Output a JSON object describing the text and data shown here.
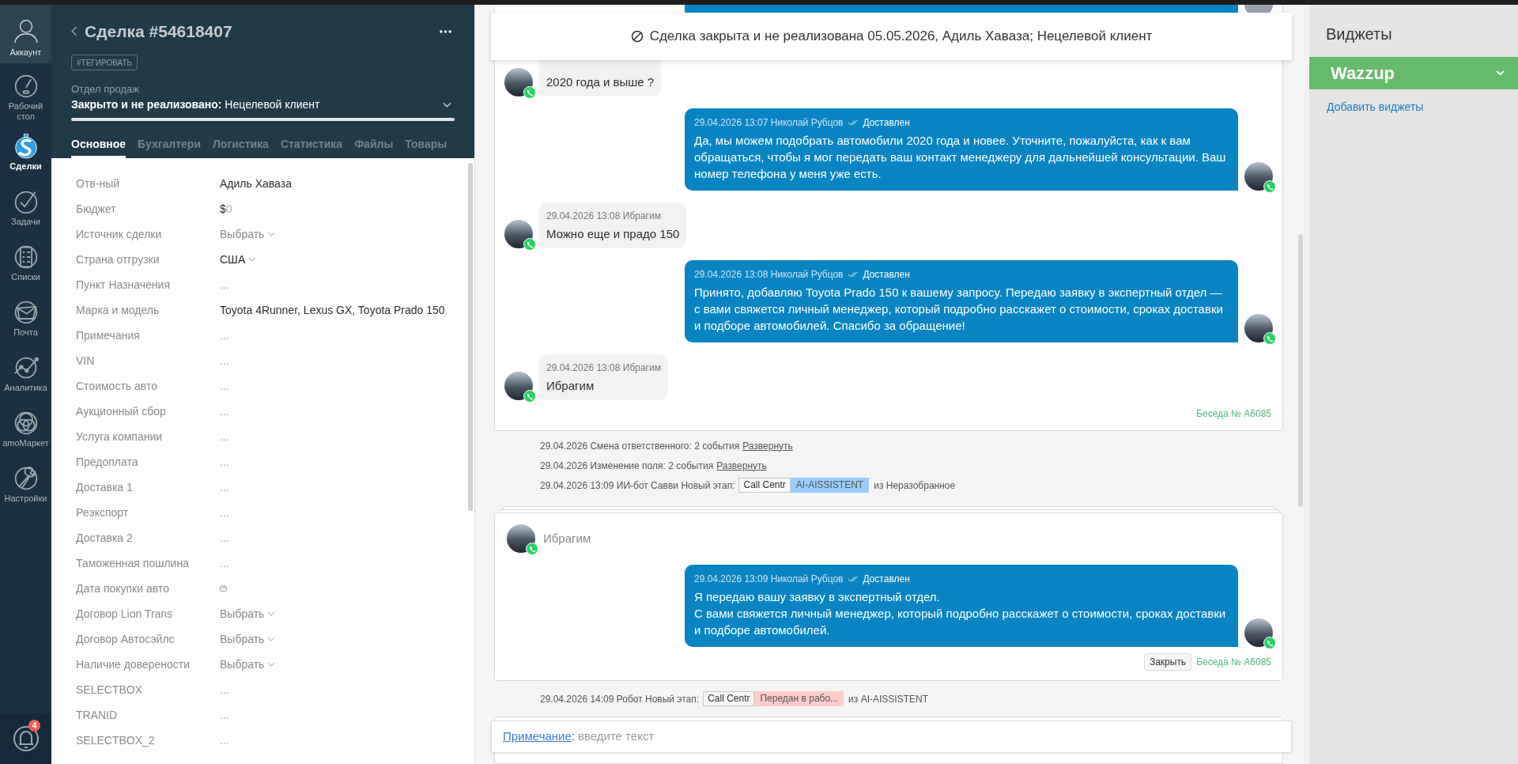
{
  "nav": {
    "account": {
      "label": "Аккаунт"
    },
    "items": [
      {
        "label": "Рабочий стол",
        "selected": false
      },
      {
        "label": "Сделки",
        "selected": true
      },
      {
        "label": "Задачи",
        "selected": false
      },
      {
        "label": "Списки",
        "selected": false
      },
      {
        "label": "Почта",
        "selected": false
      },
      {
        "label": "Аналитика",
        "selected": false
      },
      {
        "label": "amoМаркет",
        "selected": false
      },
      {
        "label": "Настройки",
        "selected": false
      }
    ],
    "notifications": {
      "badge": "4"
    }
  },
  "deal": {
    "title": "Сделка #54618407",
    "tag_button": "#ТЕГИРОВАТЬ",
    "pipeline": "Отдел продаж",
    "status": "**Закрыто и не реализовано:** Нецелевой клиент",
    "status_progress": {
      "level": 1
    },
    "tabs": [
      {
        "label": "Основное",
        "selected": true
      },
      {
        "label": "Бухгалтери",
        "selected": false
      },
      {
        "label": "Логистика",
        "selected": false
      },
      {
        "label": "Статистика",
        "selected": false
      },
      {
        "label": "Файлы",
        "selected": false
      },
      {
        "label": "Товары",
        "selected": false
      }
    ],
    "fields": [
      {
        "label": "Отв-ный",
        "kind": "text",
        "value": "Адиль Хаваза"
      },
      {
        "label": "Бюджет",
        "kind": "budget",
        "currency": "$",
        "value": "0"
      },
      {
        "label": "Источник сделки",
        "kind": "select",
        "placeholder": "Выбрать"
      },
      {
        "label": "Страна отгрузки",
        "kind": "select",
        "value": "США"
      },
      {
        "label": "Пункт Назначения",
        "kind": "empty",
        "placeholder": "..."
      },
      {
        "label": "Марка и модель",
        "kind": "text",
        "value": "Toyota 4Runner, Lexus GX, Toyota Prado 150"
      },
      {
        "label": "Примечания",
        "kind": "empty",
        "placeholder": "..."
      },
      {
        "label": "VIN",
        "kind": "empty",
        "placeholder": "..."
      },
      {
        "label": "Стоимость авто",
        "kind": "empty",
        "placeholder": "..."
      },
      {
        "label": "Аукционный сбор",
        "kind": "empty",
        "placeholder": "..."
      },
      {
        "label": "Услуга компании",
        "kind": "empty",
        "placeholder": "..."
      },
      {
        "label": "Предоплата",
        "kind": "empty",
        "placeholder": "..."
      },
      {
        "label": "Доставка 1",
        "kind": "empty",
        "placeholder": "..."
      },
      {
        "label": "Реэкспорт",
        "kind": "empty",
        "placeholder": "..."
      },
      {
        "label": "Доставка 2",
        "kind": "empty",
        "placeholder": "..."
      },
      {
        "label": "Таможенная пошлина",
        "kind": "empty",
        "placeholder": "..."
      },
      {
        "label": "Дата покупки авто",
        "kind": "date"
      },
      {
        "label": "Договор Lion Trans",
        "kind": "select",
        "placeholder": "Выбрать"
      },
      {
        "label": "Договор Автосэйлс",
        "kind": "select",
        "placeholder": "Выбрать"
      },
      {
        "label": "Наличие доверености",
        "kind": "select",
        "placeholder": "Выбрать"
      },
      {
        "label": "SELECTBOX",
        "kind": "empty",
        "placeholder": "..."
      },
      {
        "label": "TRANID",
        "kind": "empty",
        "placeholder": "..."
      },
      {
        "label": "SELECTBOX_2",
        "kind": "empty",
        "placeholder": "..."
      }
    ]
  },
  "chat": {
    "banner": "Сделка закрыта и не реализована 05.05.2026, Адиль Хаваза; Нецелевой клиент",
    "feed": [
      {
        "kind": "partial_card",
        "messages": [
          {
            "kind": "incoming",
            "text": "2020 года и выше ?"
          },
          {
            "kind": "outgoing",
            "meta": "29.04.2026 13:07 Николай Рубцов",
            "status": "Доставлен",
            "text": "Да, мы можем подобрать автомобили 2020 года и новее. Уточните, пожалуйста, как к вам обращаться, чтобы я мог передать ваш контакт менеджеру для дальнейшей консультации. Ваш номер телефона у меня уже есть."
          },
          {
            "kind": "incoming",
            "meta": "29.04.2026 13:08 Ибрагим",
            "text": "Можно еще и прадо 150"
          },
          {
            "kind": "outgoing",
            "meta": "29.04.2026 13:08 Николай Рубцов",
            "status": "Доставлен",
            "text": "Принято, добавляю Toyota Prado 150 к вашему запросу. Передаю заявку в экспертный отдел — с вами свяжется личный менеджер, который подробно расскажет о стоимости, сроках доставки и подборе автомобилей. Спасибо за обращение!"
          },
          {
            "kind": "incoming",
            "meta": "29.04.2026 13:08 Ибрагим",
            "text": "Ибрагим"
          }
        ],
        "conversation": "Беседа № A6085"
      },
      {
        "kind": "event",
        "text": "29.04.2026 Смена ответственного: 2 события",
        "link": "Развернуть"
      },
      {
        "kind": "event",
        "text": "29.04.2026 Изменение поля: 2 события",
        "link": "Развернуть"
      },
      {
        "kind": "stage",
        "text": "29.04.2026 13:09 ИИ-бот Савви Новый этап:",
        "pipeline": "Call Centr",
        "stage": "AI-AISSISTENT",
        "color": "#99ccff",
        "from": "из Неразобранное"
      },
      {
        "kind": "stacked_card",
        "contact": "Ибрагим",
        "messages": [
          {
            "kind": "outgoing",
            "meta": "29.04.2026 13:09 Николай Рубцов",
            "status": "Доставлен",
            "text": "Я передаю вашу заявку в экспертный отдел.\nС вами свяжется личный менеджер, который подробно расскажет о стоимости, сроках доставки и подборе автомобилей."
          }
        ],
        "close_button": "Закрыть",
        "conversation": "Беседа № A6085"
      },
      {
        "kind": "stage",
        "text": "29.04.2026 14:09 Робот Новый этап:",
        "pipeline": "Call Centr",
        "stage": "Передан в рабо...",
        "color": "#ffcccc",
        "from": "из AI-AISSISTENT"
      },
      {
        "kind": "peek"
      }
    ],
    "note": {
      "type_link": "Примечание",
      "separator": ":",
      "placeholder": "введите текст"
    }
  },
  "widgets": {
    "title": "Виджеты",
    "items": [
      {
        "label": "Wazzup",
        "expanded": false
      }
    ],
    "add_link": "Добавить виджеты"
  }
}
